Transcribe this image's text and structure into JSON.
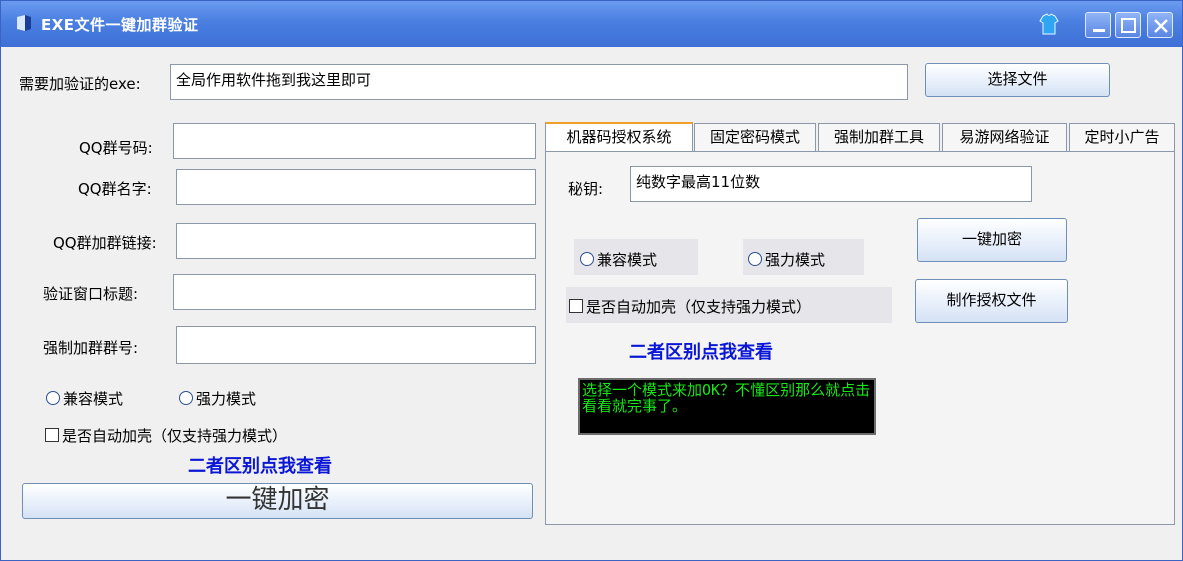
{
  "window": {
    "title": "EXE文件一键加群验证"
  },
  "top": {
    "exe_label": "需要加验证的exe:",
    "exe_value": "全局作用软件拖到我这里即可",
    "choose_button": "选择文件"
  },
  "left": {
    "qq_number_label": "QQ群号码:",
    "qq_name_label": "QQ群名字:",
    "qq_link_label": "QQ群加群链接:",
    "verify_title_label": "验证窗口标题:",
    "force_group_label": "强制加群群号:",
    "radio_compat": "兼容模式",
    "radio_strong": "强力模式",
    "auto_shell": "是否自动加壳（仅支持强力模式）",
    "diff_link": "二者区别点我查看",
    "encrypt_button": "一键加密"
  },
  "tabs": [
    {
      "label": "机器码授权系统"
    },
    {
      "label": "固定密码模式"
    },
    {
      "label": "强制加群工具"
    },
    {
      "label": "易游网络验证"
    },
    {
      "label": "定时小广告"
    }
  ],
  "panel": {
    "key_label": "秘钥:",
    "key_value": "纯数字最高11位数",
    "radio_compat": "兼容模式",
    "radio_strong": "强力模式",
    "auto_shell": "是否自动加壳（仅支持强力模式）",
    "diff_link": "二者区别点我查看",
    "encrypt_button": "一键加密",
    "license_button": "制作授权文件",
    "notice": "选择一个模式来加OK？不懂区别那么就点击看看就完事了。"
  },
  "colors": {
    "title_bar": "#4a7fe0",
    "link_blue": "#0a16d6",
    "notice_green": "#19e619",
    "active_tab_accent": "#f0a028"
  }
}
